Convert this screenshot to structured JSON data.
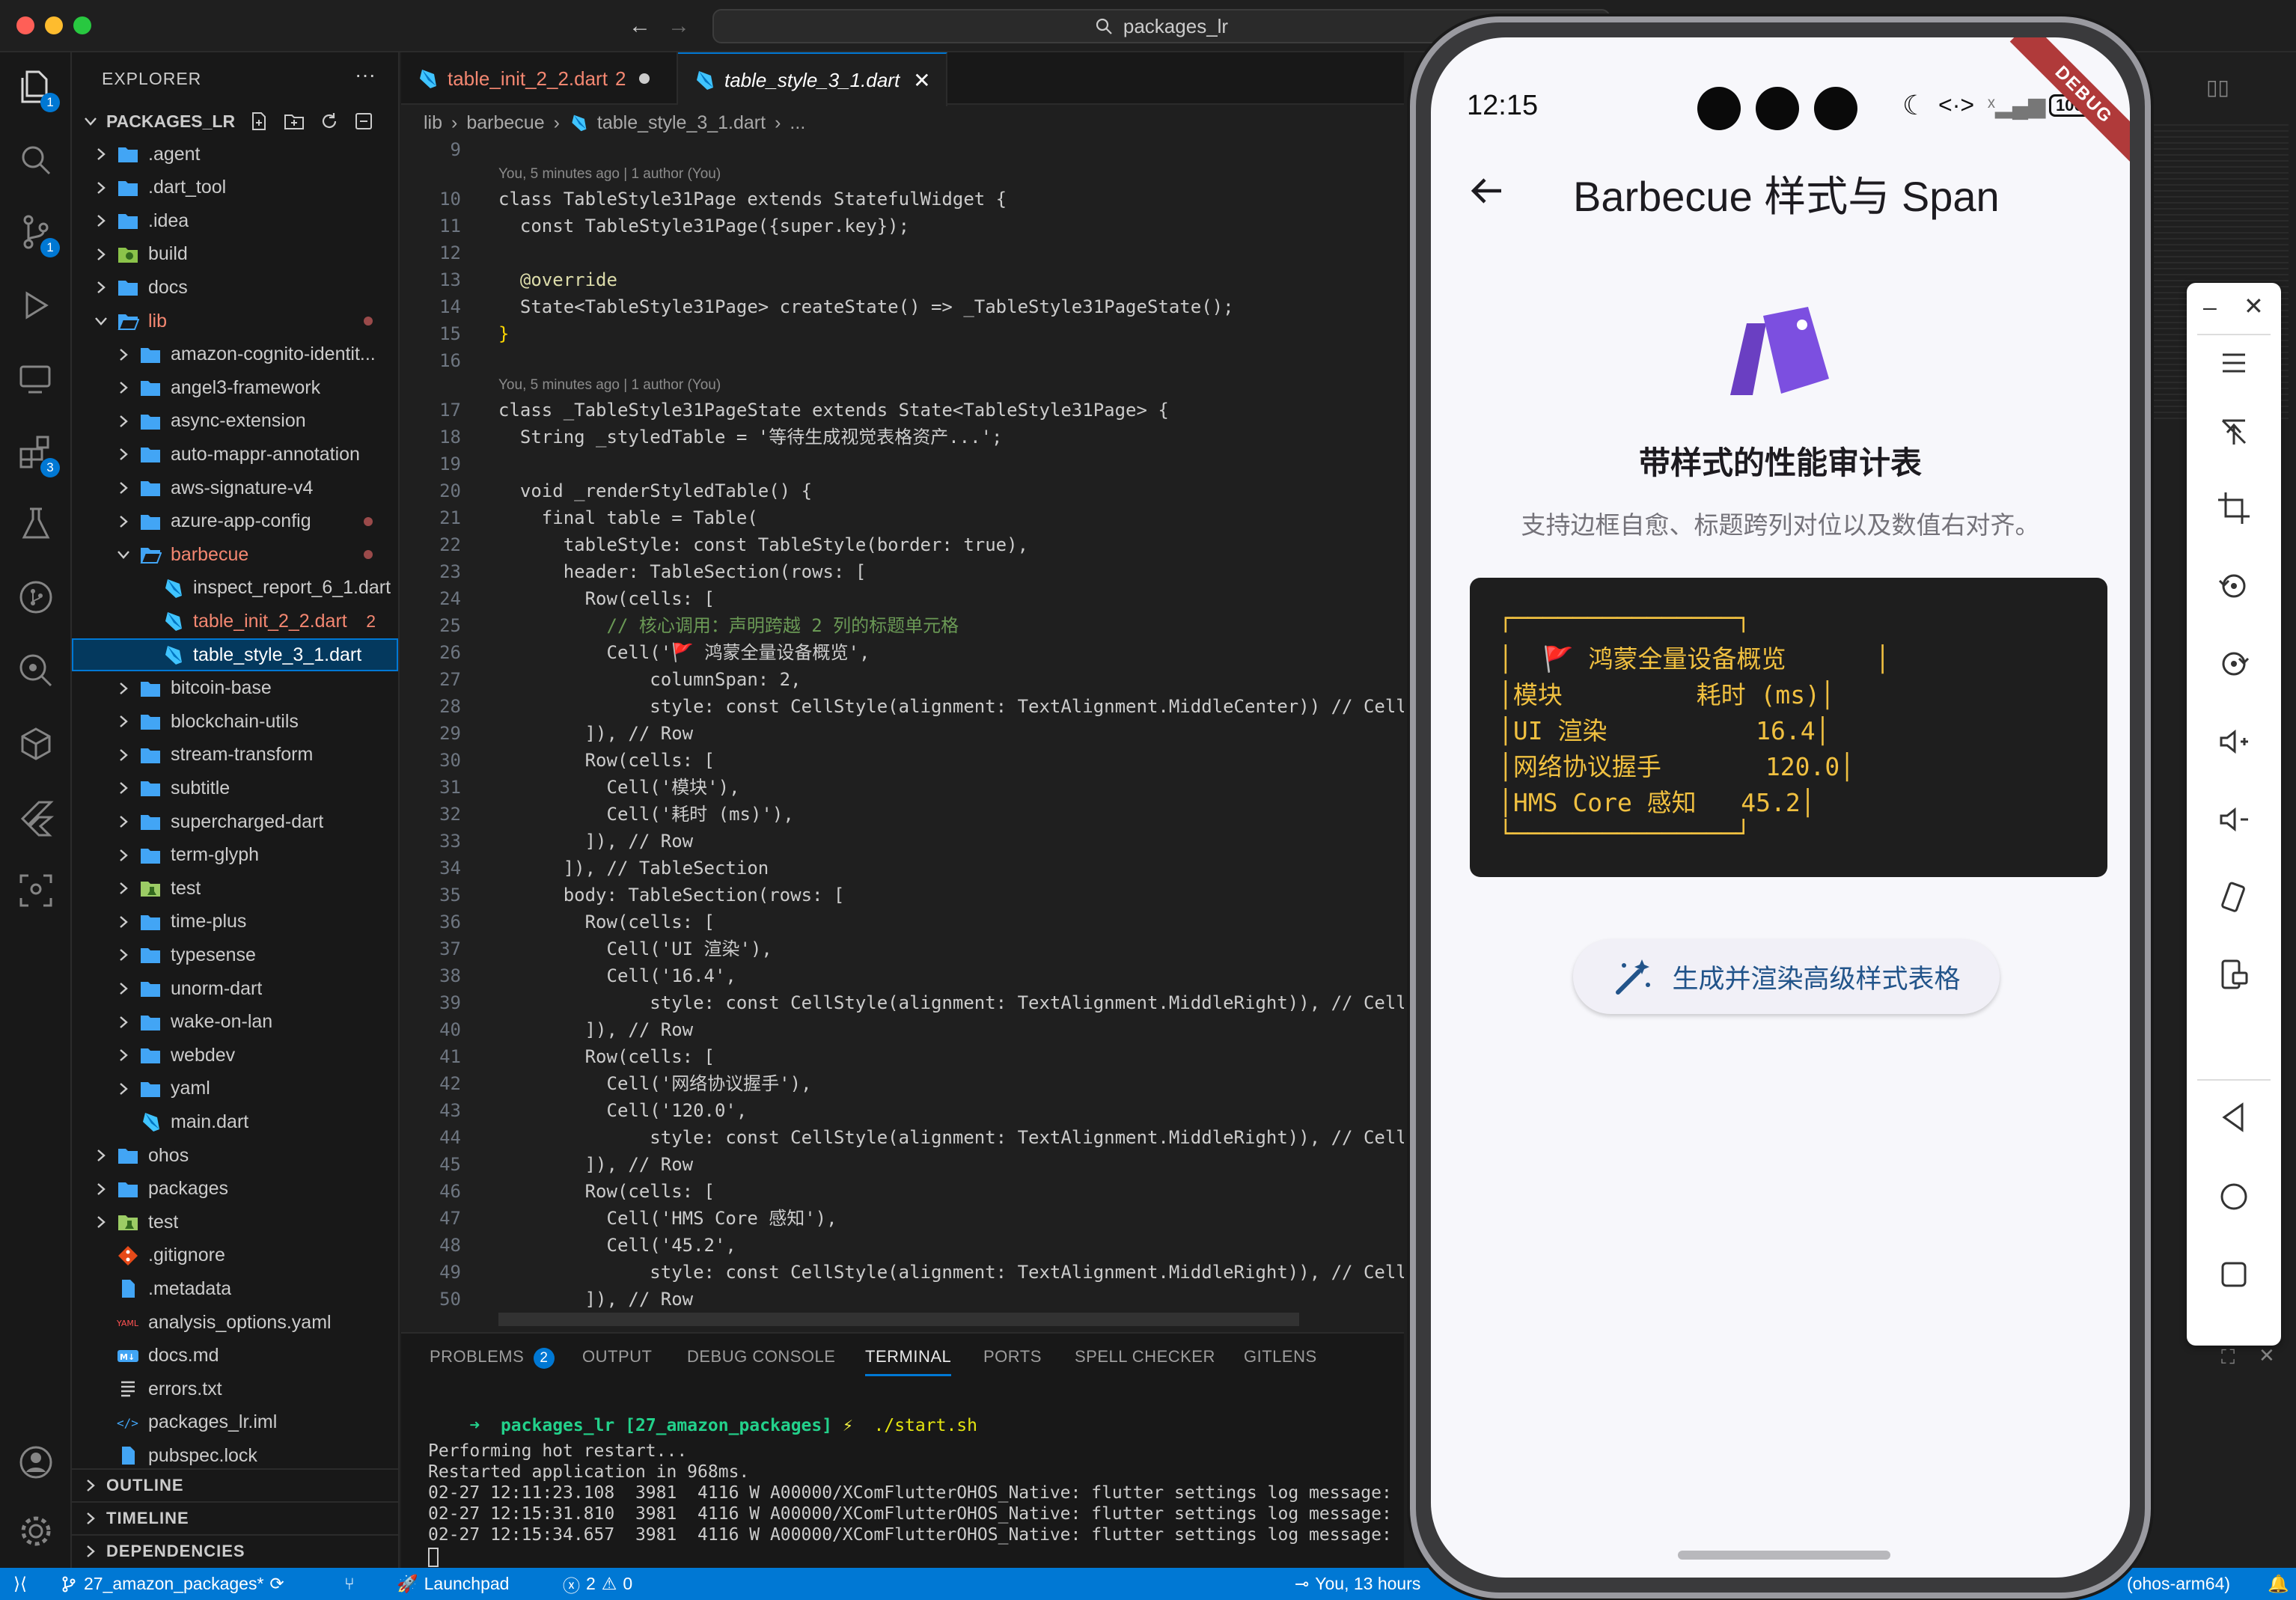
{
  "window": {
    "search": "packages_lr"
  },
  "activity": {
    "explorer_badge": "1",
    "scm_badge": "1",
    "ext_badge": "3"
  },
  "explorer": {
    "title": "EXPLORER",
    "more": "···",
    "root": "PACKAGES_LR",
    "items": [
      {
        "label": ".agent",
        "depth": 0,
        "kind": "folder",
        "open": false
      },
      {
        "label": ".dart_tool",
        "depth": 0,
        "kind": "folder",
        "open": false
      },
      {
        "label": ".idea",
        "depth": 0,
        "kind": "folder",
        "open": false
      },
      {
        "label": "build",
        "depth": 0,
        "kind": "folder-build",
        "open": false
      },
      {
        "label": "docs",
        "depth": 0,
        "kind": "folder",
        "open": false
      },
      {
        "label": "lib",
        "depth": 0,
        "kind": "folder",
        "open": true,
        "status": "error-dot"
      },
      {
        "label": "amazon-cognito-identit...",
        "depth": 1,
        "kind": "folder",
        "open": false
      },
      {
        "label": "angel3-framework",
        "depth": 1,
        "kind": "folder",
        "open": false
      },
      {
        "label": "async-extension",
        "depth": 1,
        "kind": "folder",
        "open": false
      },
      {
        "label": "auto-mappr-annotation",
        "depth": 1,
        "kind": "folder",
        "open": false
      },
      {
        "label": "aws-signature-v4",
        "depth": 1,
        "kind": "folder",
        "open": false
      },
      {
        "label": "azure-app-config",
        "depth": 1,
        "kind": "folder",
        "open": false,
        "status": "dot"
      },
      {
        "label": "barbecue",
        "depth": 1,
        "kind": "folder",
        "open": true,
        "status": "error-dot"
      },
      {
        "label": "inspect_report_6_1.dart",
        "depth": 2,
        "kind": "dart"
      },
      {
        "label": "table_init_2_2.dart",
        "depth": 2,
        "kind": "dart",
        "error": "2"
      },
      {
        "label": "table_style_3_1.dart",
        "depth": 2,
        "kind": "dart",
        "selected": true
      },
      {
        "label": "bitcoin-base",
        "depth": 1,
        "kind": "folder",
        "open": false
      },
      {
        "label": "blockchain-utils",
        "depth": 1,
        "kind": "folder",
        "open": false
      },
      {
        "label": "stream-transform",
        "depth": 1,
        "kind": "folder",
        "open": false
      },
      {
        "label": "subtitle",
        "depth": 1,
        "kind": "folder",
        "open": false
      },
      {
        "label": "supercharged-dart",
        "depth": 1,
        "kind": "folder",
        "open": false
      },
      {
        "label": "term-glyph",
        "depth": 1,
        "kind": "folder",
        "open": false
      },
      {
        "label": "test",
        "depth": 1,
        "kind": "folder-test",
        "open": false
      },
      {
        "label": "time-plus",
        "depth": 1,
        "kind": "folder",
        "open": false
      },
      {
        "label": "typesense",
        "depth": 1,
        "kind": "folder",
        "open": false
      },
      {
        "label": "unorm-dart",
        "depth": 1,
        "kind": "folder",
        "open": false
      },
      {
        "label": "wake-on-lan",
        "depth": 1,
        "kind": "folder",
        "open": false
      },
      {
        "label": "webdev",
        "depth": 1,
        "kind": "folder",
        "open": false
      },
      {
        "label": "yaml",
        "depth": 1,
        "kind": "folder",
        "open": false
      },
      {
        "label": "main.dart",
        "depth": 1,
        "kind": "dart"
      },
      {
        "label": "ohos",
        "depth": 0,
        "kind": "folder",
        "open": false
      },
      {
        "label": "packages",
        "depth": 0,
        "kind": "folder",
        "open": false
      },
      {
        "label": "test",
        "depth": 0,
        "kind": "folder-test",
        "open": false
      },
      {
        "label": ".gitignore",
        "depth": 0,
        "kind": "git"
      },
      {
        "label": ".metadata",
        "depth": 0,
        "kind": "file"
      },
      {
        "label": "analysis_options.yaml",
        "depth": 0,
        "kind": "yaml"
      },
      {
        "label": "docs.md",
        "depth": 0,
        "kind": "md"
      },
      {
        "label": "errors.txt",
        "depth": 0,
        "kind": "txt"
      },
      {
        "label": "packages_lr.iml",
        "depth": 0,
        "kind": "xml"
      },
      {
        "label": "pubspec.lock",
        "depth": 0,
        "kind": "file"
      }
    ],
    "sections": [
      "OUTLINE",
      "TIMELINE",
      "DEPENDENCIES"
    ]
  },
  "tabs": [
    {
      "label": "table_init_2_2.dart",
      "count": "2",
      "active": false
    },
    {
      "label": "table_style_3_1.dart",
      "active": true
    }
  ],
  "breadcrumb": [
    "lib",
    "barbecue",
    "table_style_3_1.dart",
    "..."
  ],
  "blame": {
    "a": "You, 5 minutes ago | 1 author (You)",
    "b": "You, 5 minutes ago | 1 author (You)"
  },
  "code_lines": [
    "9",
    "10",
    "11",
    "12",
    "13",
    "14",
    "15",
    "16",
    "17",
    "18",
    "19",
    "20",
    "21",
    "22",
    "23",
    "24",
    "25",
    "26",
    "27",
    "28",
    "29",
    "30",
    "31",
    "32",
    "33",
    "34",
    "35",
    "36",
    "37",
    "38",
    "39",
    "40",
    "41",
    "42",
    "43",
    "44",
    "45",
    "46",
    "47",
    "48",
    "49",
    "50"
  ],
  "code": {
    "l10": "class TableStyle31Page extends StatefulWidget {",
    "l11": "  const TableStyle31Page({super.key});",
    "l13": "  @override",
    "l14": "  State<TableStyle31Page> createState() => _TableStyle31PageState();",
    "l15": "}",
    "l17": "class _TableStyle31PageState extends State<TableStyle31Page> {",
    "l18": "  String _styledTable = '等待生成视觉表格资产...';",
    "l20": "  void _renderStyledTable() {",
    "l21": "    final table = Table(",
    "l22": "      tableStyle: const TableStyle(border: true),",
    "l23": "      header: TableSection(rows: [",
    "l24": "        Row(cells: [",
    "l25": "          // 核心调用：声明跨越 2 列的标题单元格",
    "l26": "          Cell('🚩 鸿蒙全量设备概览',",
    "l27": "              columnSpan: 2,",
    "l28": "              style: const CellStyle(alignment: TextAlignment.MiddleCenter)) // Cell",
    "l29": "        ]), // Row",
    "l30": "        Row(cells: [",
    "l31": "          Cell('模块'),",
    "l32": "          Cell('耗时 (ms)'),",
    "l33": "        ]), // Row",
    "l34": "      ]), // TableSection",
    "l35": "      body: TableSection(rows: [",
    "l36": "        Row(cells: [",
    "l37": "          Cell('UI 渲染'),",
    "l38": "          Cell('16.4',",
    "l39": "              style: const CellStyle(alignment: TextAlignment.MiddleRight)), // Cell",
    "l40": "        ]), // Row",
    "l41": "        Row(cells: [",
    "l42": "          Cell('网络协议握手'),",
    "l43": "          Cell('120.0',",
    "l44": "              style: const CellStyle(alignment: TextAlignment.MiddleRight)), // Cell",
    "l45": "        ]), // Row",
    "l46": "        Row(cells: [",
    "l47": "          Cell('HMS Core 感知'),",
    "l48": "          Cell('45.2',",
    "l49": "              style: const CellStyle(alignment: TextAlignment.MiddleRight)), // Cell",
    "l50": "        ]), // Row"
  },
  "panel": {
    "tabs": [
      "PROBLEMS",
      "OUTPUT",
      "DEBUG CONSOLE",
      "TERMINAL",
      "PORTS",
      "SPELL CHECKER",
      "GITLENS"
    ],
    "problems_count": "2",
    "prompt_dir": "packages_lr",
    "prompt_branch": "[27_amazon_packages]",
    "prompt_cmd": "./start.sh",
    "lines": [
      "Performing hot restart...",
      "Restarted application in 968ms.",
      "02-27 12:11:23.108  3981  4116 W A00000/XComFlutterOHOS_Native: flutter settings log message:",
      "02-27 12:15:31.810  3981  4116 W A00000/XComFlutterOHOS_Native: flutter settings log message:",
      "02-27 12:15:34.657  3981  4116 W A00000/XComFlutterOHOS_Native: flutter settings log message:"
    ]
  },
  "status": {
    "branch": "27_amazon_packages*",
    "launchpad": "Launchpad",
    "errors": "2",
    "warnings": "0",
    "blame": "You, 13 hours",
    "platform": "(ohos-arm64)"
  },
  "phone": {
    "time": "12:15",
    "battery": "100",
    "debug": "DEBUG",
    "app_title": "Barbecue 样式与 Span",
    "card_title": "带样式的性能审计表",
    "card_subtitle": "支持边框自愈、标题跨列对位以及数值右对齐。",
    "table_lines": [
      "┌───────────────┐",
      "│  🚩 鸿蒙全量设备概览      │",
      "│模块         耗时 (ms)│",
      "│UI 渲染          16.4│",
      "│网络协议握手       120.0│",
      "│HMS Core 感知   45.2│",
      "└───────────────┘"
    ],
    "button_label": "生成并渲染高级样式表格",
    "accent": "#6a3fc2"
  }
}
